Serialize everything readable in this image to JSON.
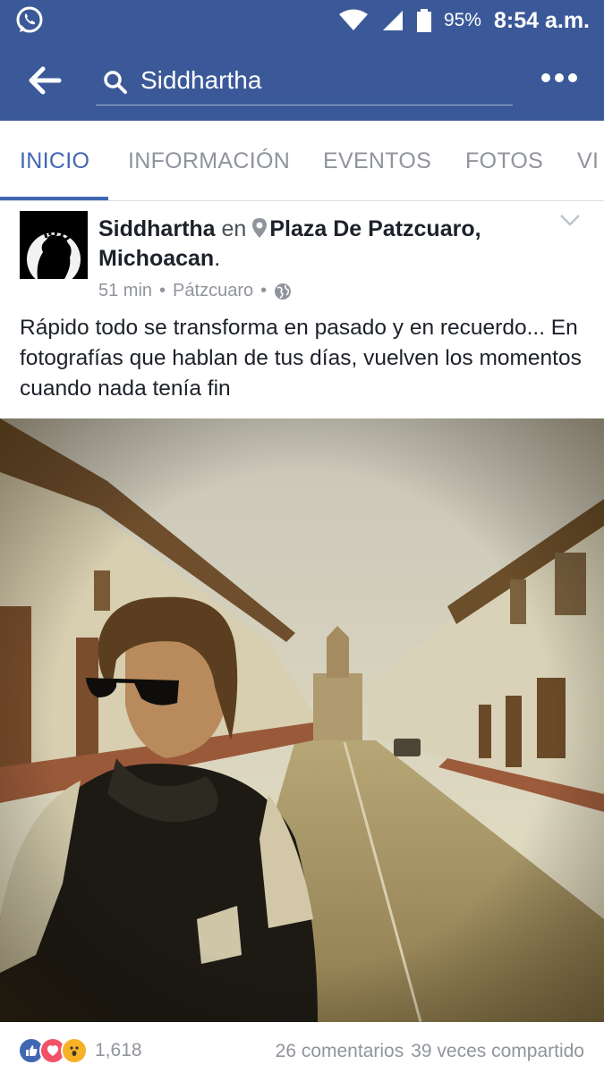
{
  "status_bar": {
    "app_icon": "whatsapp-icon",
    "battery": "95%",
    "time": "8:54 a.m."
  },
  "toolbar": {
    "search_text": "Siddhartha",
    "back_icon": "back-arrow-icon",
    "more_icon": "more-options-icon"
  },
  "tabs": [
    {
      "label": "INICIO",
      "active": true
    },
    {
      "label": "INFORMACIÓN",
      "active": false
    },
    {
      "label": "EVENTOS",
      "active": false
    },
    {
      "label": "FOTOS",
      "active": false
    },
    {
      "label": "VI",
      "active": false
    }
  ],
  "post": {
    "author": "Siddhartha",
    "connector": "en",
    "location": "Plaza De Patzcuaro, Michoacan",
    "location_end": ".",
    "time": "51 min",
    "place": "Pátzcuaro",
    "separator": "•",
    "text": "Rápido todo se transforma en pasado y en recuerdo... En fotografías que hablan de tus días, vuelven los momentos cuando nada tenía fin",
    "reaction_count": "1,618",
    "comments": "26 comentarios",
    "shares": "39 veces compartido"
  },
  "colors": {
    "brand": "#3b5998",
    "tab_active": "#4267b2",
    "muted": "#90949c"
  }
}
